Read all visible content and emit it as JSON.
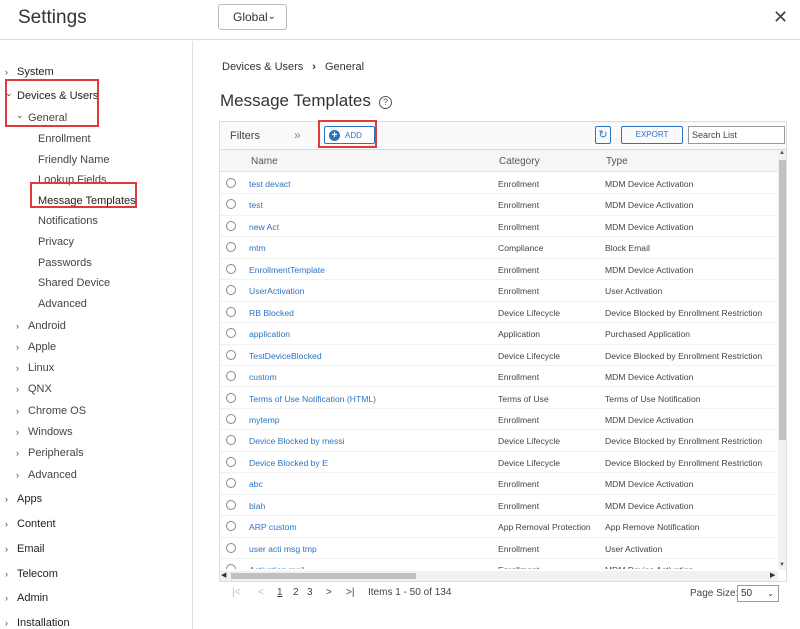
{
  "header": {
    "title": "Settings",
    "scope_value": "Global",
    "close_glyph": "✕"
  },
  "sidebar": {
    "items": [
      {
        "label": "System",
        "level": 0,
        "expanded": false
      },
      {
        "label": "Devices & Users",
        "level": 0,
        "expanded": true
      },
      {
        "label": "General",
        "level": 1,
        "expanded": true
      },
      {
        "label": "Enrollment",
        "level": 2
      },
      {
        "label": "Friendly Name",
        "level": 2
      },
      {
        "label": "Lookup Fields",
        "level": 2
      },
      {
        "label": "Message Templates",
        "level": 2,
        "selected": true
      },
      {
        "label": "Notifications",
        "level": 2
      },
      {
        "label": "Privacy",
        "level": 2
      },
      {
        "label": "Passwords",
        "level": 2
      },
      {
        "label": "Shared Device",
        "level": 2
      },
      {
        "label": "Advanced",
        "level": 2
      },
      {
        "label": "Android",
        "level": 1
      },
      {
        "label": "Apple",
        "level": 1
      },
      {
        "label": "Linux",
        "level": 1
      },
      {
        "label": "QNX",
        "level": 1
      },
      {
        "label": "Chrome OS",
        "level": 1
      },
      {
        "label": "Windows",
        "level": 1
      },
      {
        "label": "Peripherals",
        "level": 1
      },
      {
        "label": "Advanced",
        "level": 1
      },
      {
        "label": "Apps",
        "level": 0
      },
      {
        "label": "Content",
        "level": 0
      },
      {
        "label": "Email",
        "level": 0
      },
      {
        "label": "Telecom",
        "level": 0
      },
      {
        "label": "Admin",
        "level": 0
      },
      {
        "label": "Installation",
        "level": 0
      }
    ]
  },
  "breadcrumb": {
    "parent": "Devices & Users",
    "separator": "›",
    "current": "General"
  },
  "page": {
    "title": "Message Templates",
    "help_glyph": "?"
  },
  "toolbar": {
    "filters_label": "Filters",
    "filters_chevron": "»",
    "add_label": "ADD",
    "refresh_glyph": "↻",
    "export_label": "EXPORT",
    "search_placeholder": "Search List"
  },
  "table": {
    "columns": [
      "Name",
      "Category",
      "Type"
    ],
    "rows": [
      {
        "name": "test devact",
        "category": "Enrollment",
        "type": "MDM Device Activation"
      },
      {
        "name": "test",
        "category": "Enrollment",
        "type": "MDM Device Activation"
      },
      {
        "name": "new Act",
        "category": "Enrollment",
        "type": "MDM Device Activation"
      },
      {
        "name": "mtm",
        "category": "Compliance",
        "type": "Block Email"
      },
      {
        "name": "EnrollmentTemplate",
        "category": "Enrollment",
        "type": "MDM Device Activation"
      },
      {
        "name": "UserActivation",
        "category": "Enrollment",
        "type": "User Activation"
      },
      {
        "name": "RB Blocked",
        "category": "Device Lifecycle",
        "type": "Device Blocked by Enrollment Restriction"
      },
      {
        "name": "application",
        "category": "Application",
        "type": "Purchased Application"
      },
      {
        "name": "TestDeviceBlocked",
        "category": "Device Lifecycle",
        "type": "Device Blocked by Enrollment Restriction"
      },
      {
        "name": "custom",
        "category": "Enrollment",
        "type": "MDM Device Activation"
      },
      {
        "name": "Terms of Use Notification (HTML)",
        "category": "Terms of Use",
        "type": "Terms of Use Notification"
      },
      {
        "name": "mytemp",
        "category": "Enrollment",
        "type": "MDM Device Activation"
      },
      {
        "name": "Device Blocked by messi",
        "category": "Device Lifecycle",
        "type": "Device Blocked by Enrollment Restriction"
      },
      {
        "name": "Device Blocked by E",
        "category": "Device Lifecycle",
        "type": "Device Blocked by Enrollment Restriction"
      },
      {
        "name": "abc",
        "category": "Enrollment",
        "type": "MDM Device Activation"
      },
      {
        "name": "blah",
        "category": "Enrollment",
        "type": "MDM Device Activation"
      },
      {
        "name": "ARP custom",
        "category": "App Removal Protection",
        "type": "App Remove Notification"
      },
      {
        "name": "user acti msg tmp",
        "category": "Enrollment",
        "type": "User Activation"
      },
      {
        "name": "Activation mail",
        "category": "Enrollment",
        "type": "MDM Device Activation"
      }
    ]
  },
  "pager": {
    "first": "|<",
    "prev": "<",
    "pages": [
      "1",
      "2",
      "3"
    ],
    "current_page": "1",
    "next": ">",
    "last": ">|",
    "items_text": "Items 1 - 50 of 134",
    "page_size_label": "Page Size:",
    "page_size_value": "50"
  },
  "colors": {
    "accent": "#2b73c4",
    "highlight": "#e03a3a"
  }
}
